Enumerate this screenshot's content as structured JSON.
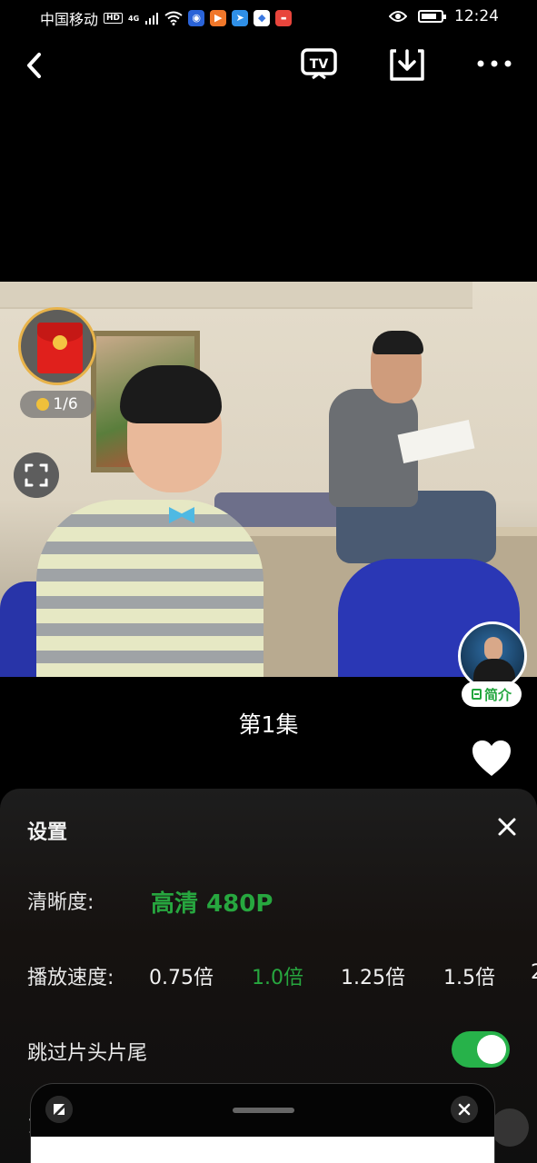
{
  "status_bar": {
    "carrier": "中国移动",
    "hd_badge": "HD",
    "network": "4G",
    "time": "12:24",
    "battery_level": 0.8,
    "app_icons": [
      {
        "name": "bulb-app-icon",
        "color": "#2a63d8"
      },
      {
        "name": "play-app-icon",
        "color": "#f0772a"
      },
      {
        "name": "arrow-app-icon",
        "color": "#2f8fe6"
      },
      {
        "name": "cube-app-icon",
        "color": "#3a78e0"
      },
      {
        "name": "red-app-icon",
        "color": "#e8453c"
      }
    ]
  },
  "video": {
    "coin_progress": "1/6",
    "intro_label": "简介"
  },
  "episode": {
    "title": "第1集"
  },
  "settings": {
    "title": "设置",
    "quality_label": "清晰度:",
    "quality_value": "高清 480P",
    "speed_label": "播放速度:",
    "speeds": [
      "0.75倍",
      "1.0倍",
      "1.25倍",
      "1.5倍",
      "2"
    ],
    "speed_selected": "1.0倍",
    "skip_label": "跳过片头片尾",
    "skip_enabled": true,
    "next_label_partial": "1"
  },
  "colors": {
    "accent": "#27a73f",
    "toggle_on": "#27b24a"
  }
}
